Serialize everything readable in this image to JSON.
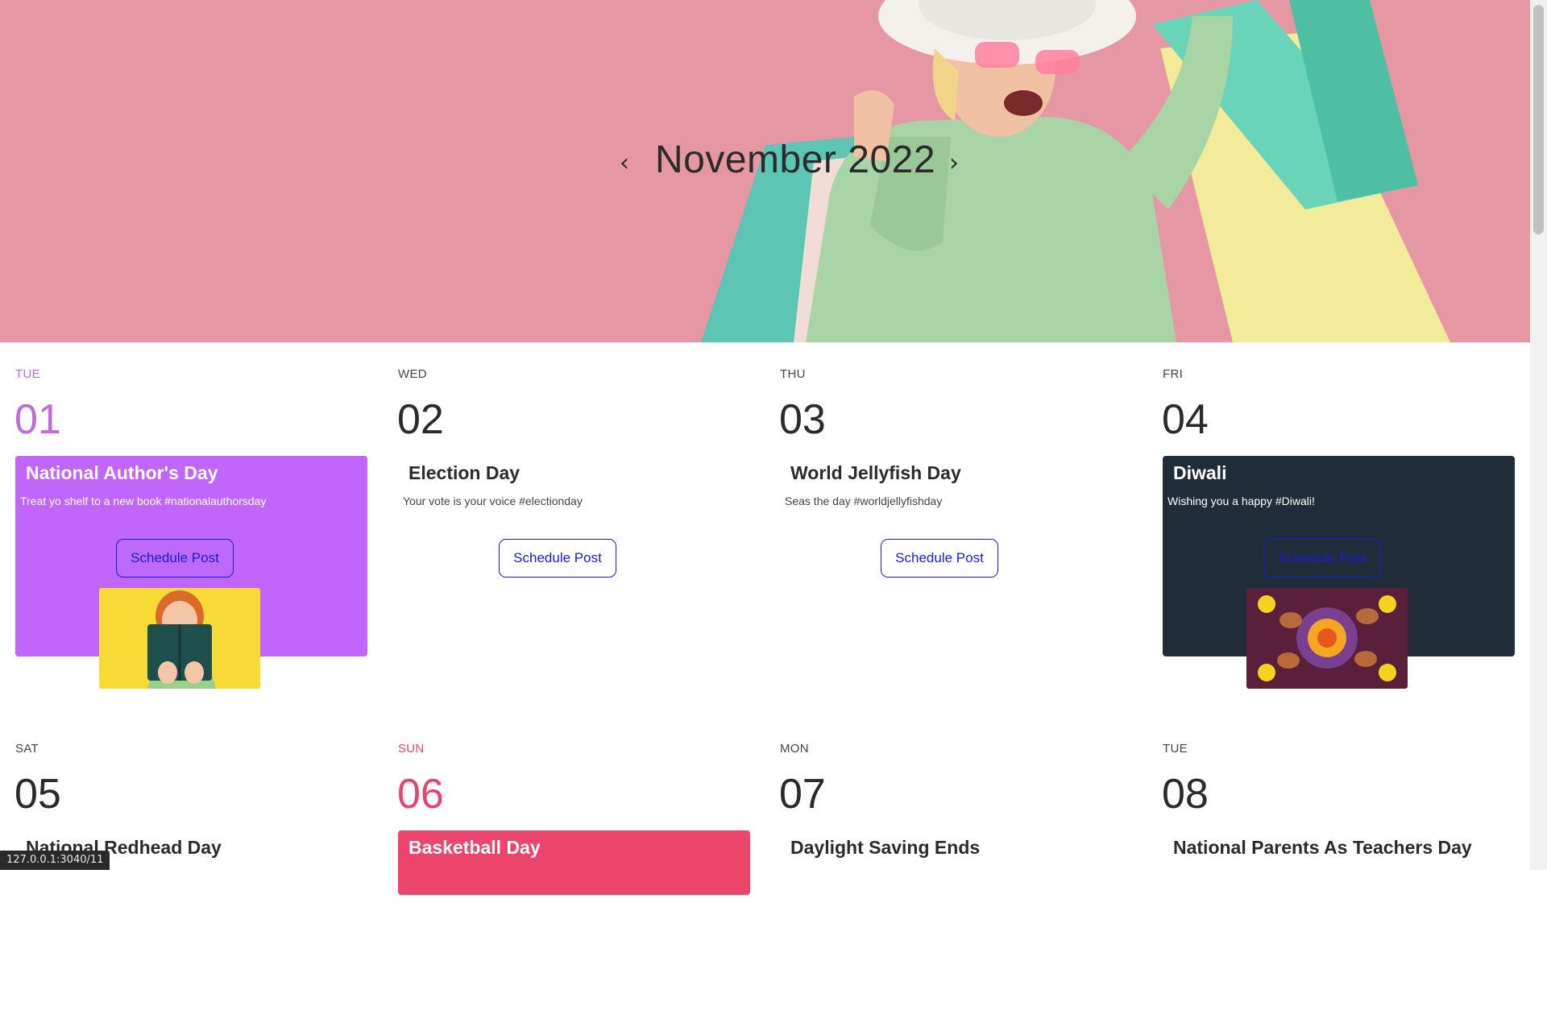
{
  "header": {
    "month_title": "November 2022",
    "prev_icon": "chevron-left-icon",
    "next_icon": "chevron-right-icon",
    "prev_glyph": "‹",
    "next_glyph": "›"
  },
  "colors": {
    "hero_bg": "#e48f9d",
    "accent_purple": "#c066fd",
    "accent_pink": "#ec456b",
    "dark_card": "#202c38",
    "button_blue": "#1c1ccf"
  },
  "days": [
    {
      "dow": "TUE",
      "num": "01",
      "title": "National Author's Day",
      "desc": "Treat yo shelf to a new book #nationalauthorsday",
      "button": "Schedule Post"
    },
    {
      "dow": "WED",
      "num": "02",
      "title": "Election Day",
      "desc": "Your vote is your voice #electionday",
      "button": "Schedule Post"
    },
    {
      "dow": "THU",
      "num": "03",
      "title": "World Jellyfish Day",
      "desc": "Seas the day #worldjellyfishday",
      "button": "Schedule Post"
    },
    {
      "dow": "FRI",
      "num": "04",
      "title": "Diwali",
      "desc": "Wishing you a happy #Diwali!",
      "button": "Schedule Post"
    },
    {
      "dow": "SAT",
      "num": "05",
      "title": "National Redhead Day"
    },
    {
      "dow": "SUN",
      "num": "06",
      "title": "Basketball Day"
    },
    {
      "dow": "MON",
      "num": "07",
      "title": "Daylight Saving Ends"
    },
    {
      "dow": "TUE",
      "num": "08",
      "title": "National Parents As Teachers Day"
    }
  ],
  "status_bar": {
    "url": "127.0.0.1:3040/11"
  }
}
